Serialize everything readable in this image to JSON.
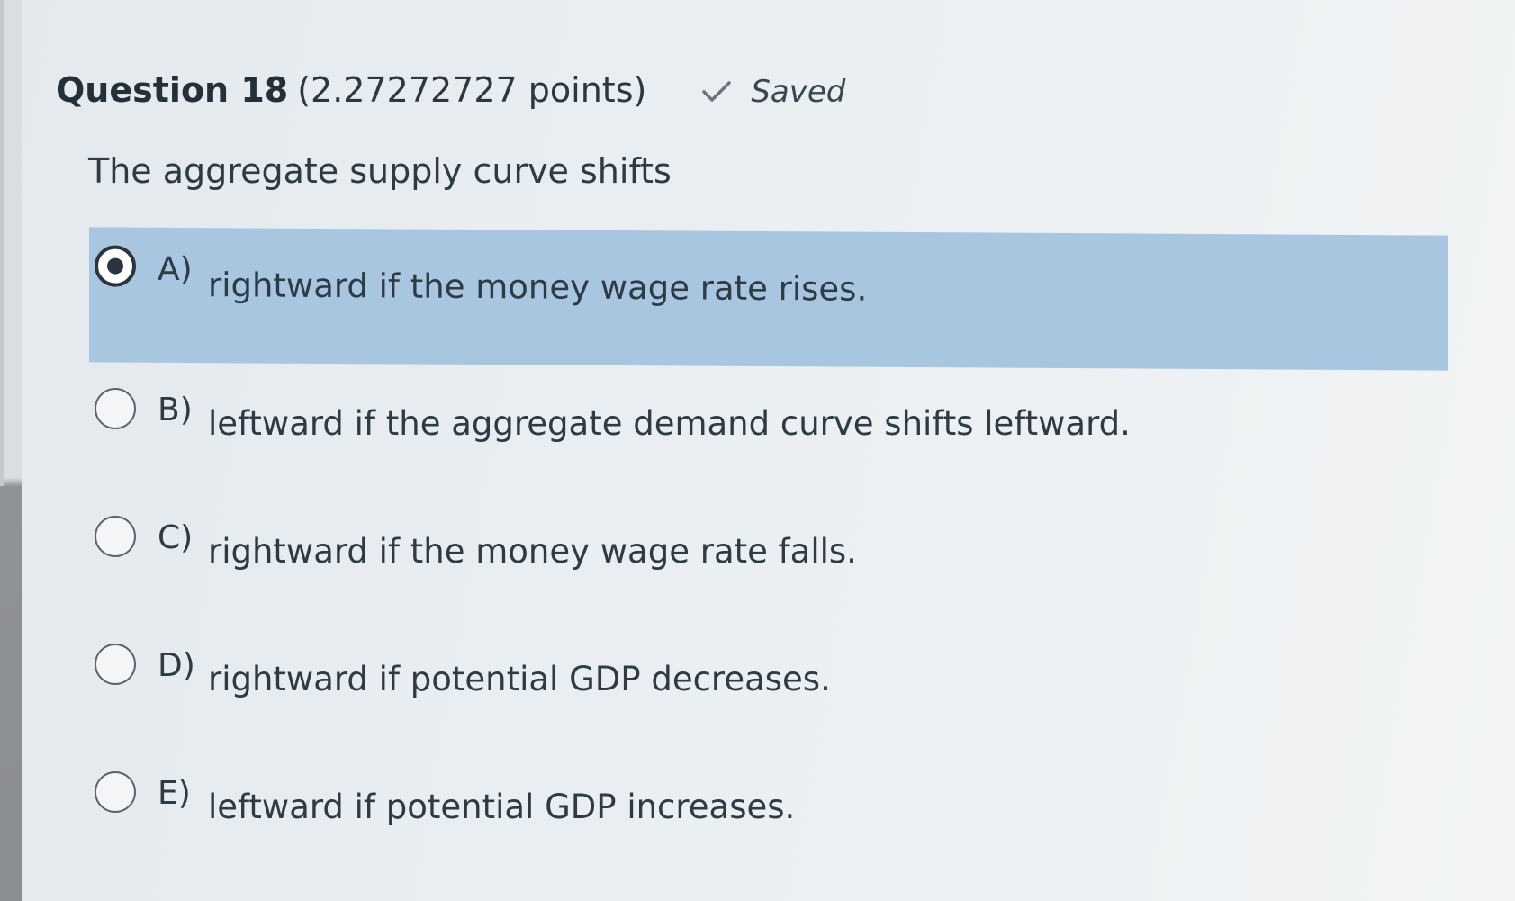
{
  "question": {
    "title": "Question 18",
    "points": "(2.27272727 points)",
    "status_icon": "check-icon",
    "status": "Saved",
    "prompt": "The aggregate supply curve shifts"
  },
  "answers": [
    {
      "letter": "A)",
      "text": "rightward if the money wage rate rises.",
      "selected": true
    },
    {
      "letter": "B)",
      "text": "leftward if the aggregate demand curve shifts leftward.",
      "selected": false
    },
    {
      "letter": "C)",
      "text": "rightward if the money wage rate falls.",
      "selected": false
    },
    {
      "letter": "D)",
      "text": "rightward if potential GDP decreases.",
      "selected": false
    },
    {
      "letter": "E)",
      "text": "leftward if potential GDP increases.",
      "selected": false
    }
  ],
  "colors": {
    "selected_background": "#a9c6e1",
    "text": "#2d3b45",
    "page_background": "#e9eef2"
  }
}
